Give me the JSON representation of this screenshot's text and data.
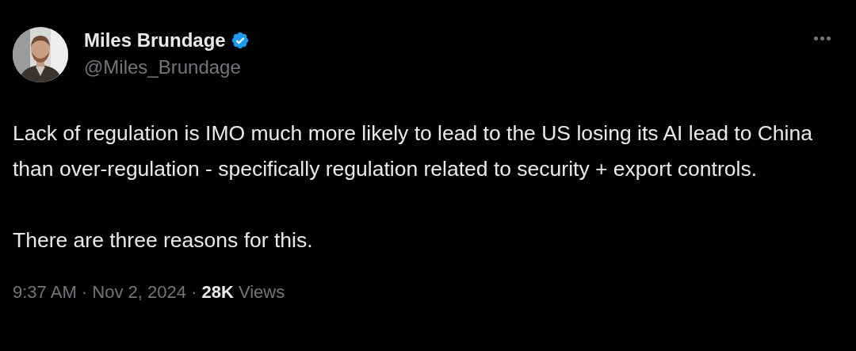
{
  "author": {
    "name": "Miles Brundage",
    "verified": true,
    "handle": "@Miles_Brundage"
  },
  "paragraphs": [
    "Lack of regulation is IMO much more likely to lead to the US losing its AI lead to China than over-regulation - specifically regulation related to security + export controls.",
    "There are three reasons for this."
  ],
  "meta": "9:37 AM · Nov 2, 2024 · **28K** Views"
}
